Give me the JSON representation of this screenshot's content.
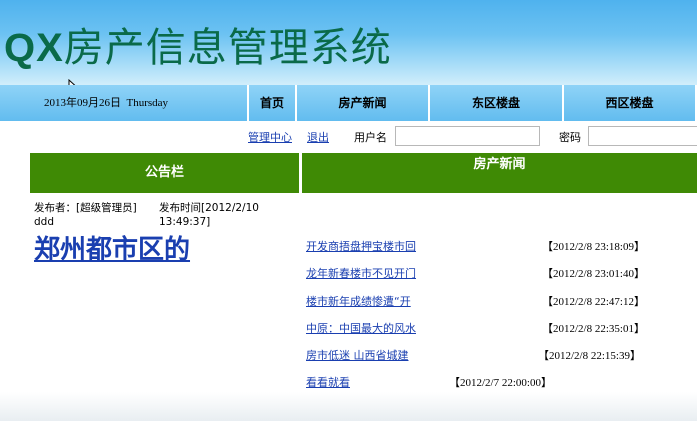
{
  "header": {
    "title_latin": "QX",
    "title_cjk": "房产信息管理系统",
    "title_color": "#0a6a49"
  },
  "navbar": {
    "date": "2013年09月26日",
    "weekday": "Thursday",
    "items": [
      {
        "label": "首页"
      },
      {
        "label": "房产新闻"
      },
      {
        "label": "东区楼盘"
      },
      {
        "label": "西区楼盘"
      }
    ]
  },
  "toolbar": {
    "admin_center": "管理中心",
    "logout": "退出",
    "username_label": "用户名",
    "password_label": "密码",
    "username_value": "",
    "password_value": ""
  },
  "notice_board": {
    "heading": "公告栏",
    "publisher_label": "发布者：[超级管理员]",
    "body": "ddd",
    "time_line1": "发布时间[2012/2/10",
    "time_line2": "13:49:37]",
    "headline": "郑州都市区的"
  },
  "news": {
    "heading": "房产新闻",
    "items": [
      {
        "title": "开发商捂盘押宝楼市回",
        "date": "【2012/2/8 23:18:09】"
      },
      {
        "title": "龙年新春楼市不见开门",
        "date": "【2012/2/8 23:01:40】"
      },
      {
        "title": "楼市新年成绩惨遭“开",
        "date": "【2012/2/8 22:47:12】"
      },
      {
        "title": "中原：中国最大的风水",
        "date": "【2012/2/8 22:35:01】"
      },
      {
        "title": "房市低迷 山西省城建",
        "date": "【2012/2/8 22:15:39】"
      },
      {
        "title": "看看就看",
        "date": "【2012/2/7 22:00:00】"
      }
    ]
  },
  "colors": {
    "header_blue": "#4fb2ee",
    "nav_blue": "#62bcef",
    "panel_green": "#3f8a05",
    "link_blue": "#1a3fb0"
  }
}
